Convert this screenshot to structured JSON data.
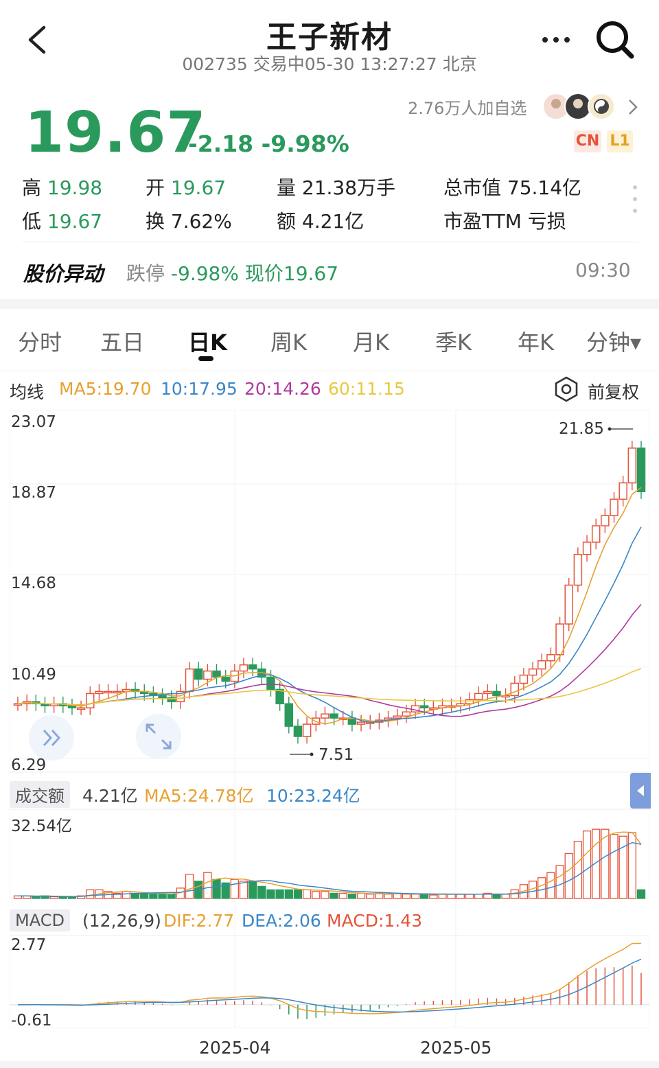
{
  "header": {
    "title": "王子新材",
    "subtitle": "002735 交易中05-30 13:27:27 北京"
  },
  "quote": {
    "price": "19.67",
    "change": "-2.18 -9.98%",
    "followers": "2.76万人加自选",
    "badge_cn": "CN",
    "badge_l1": "L1"
  },
  "stats": {
    "high_label": "高",
    "high": "19.98",
    "open_label": "开",
    "open": "19.67",
    "volume": "量 21.38万手",
    "mktcap": "总市值 75.14亿",
    "low_label": "低",
    "low": "19.67",
    "turnover": "换 7.62%",
    "amount": "额 4.21亿",
    "pe": "市盈TTM 亏损"
  },
  "alert": {
    "title": "股价异动",
    "prefix": "跌停",
    "detail": "-9.98% 现价19.67",
    "time": "09:30"
  },
  "tabs": [
    "分时",
    "五日",
    "日K",
    "周K",
    "月K",
    "季K",
    "年K",
    "分钟▾"
  ],
  "active_tab": "日K",
  "ma_legend": {
    "label": "均线",
    "ma5": "MA5:19.70",
    "ma10": "10:17.95",
    "ma20": "20:14.26",
    "ma60": "60:11.15",
    "adjust": "前复权"
  },
  "price_axis": [
    "23.07",
    "18.87",
    "14.68",
    "10.49",
    "6.29"
  ],
  "annotations": {
    "high": "21.85",
    "low": "7.51"
  },
  "volume_panel": {
    "label": "成交额",
    "value": "4.21亿",
    "ma5": "MA5:24.78亿",
    "ma10": "10:23.24亿",
    "max": "32.54亿"
  },
  "macd_panel": {
    "label": "MACD",
    "params": "(12,26,9)",
    "dif": "DIF:2.77",
    "dea": "DEA:2.06",
    "macd": "MACD:1.43",
    "max": "2.77",
    "min": "-0.61"
  },
  "dates": [
    "2025-04",
    "2025-05"
  ],
  "colors": {
    "up": "#e5533a",
    "down": "#2a9a5c",
    "ma5": "#e8a030",
    "ma10": "#3a87c8",
    "ma20": "#b03aa0",
    "ma60": "#e8c840"
  }
}
